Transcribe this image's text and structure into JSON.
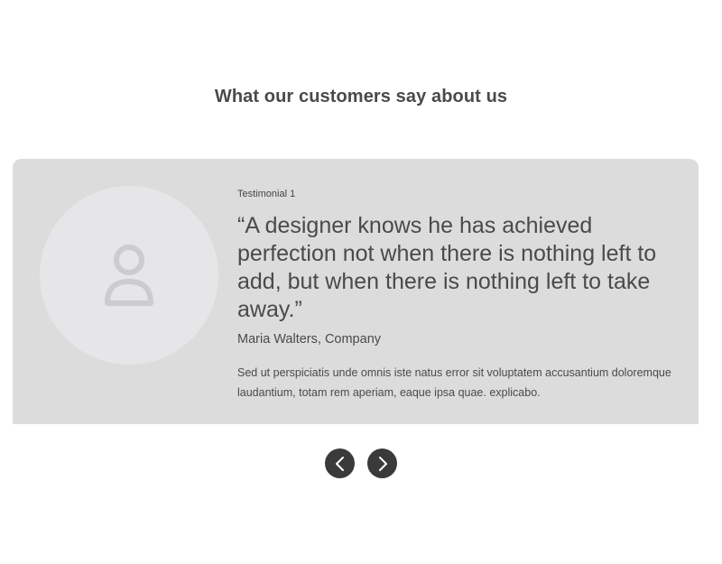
{
  "section": {
    "heading": "What our customers say about us"
  },
  "testimonial": {
    "eyebrow": "Testimonial 1",
    "quote": "“A designer knows he has achieved perfection not when there is nothing left to add, but when there is nothing left to take away.”",
    "author": "Maria Walters, Company",
    "body": "Sed ut perspiciatis unde omnis iste natus error sit voluptatem accusantium doloremque laudantium, totam rem aperiam, eaque ipsa quae. explicabo.",
    "avatar_icon": "user-icon"
  },
  "navigation": {
    "prev_icon": "chevron-left-icon",
    "next_icon": "chevron-right-icon"
  },
  "colors": {
    "card_background": "#dcdcdc",
    "avatar_background": "#e6e6e9",
    "nav_button": "#3a3a3a"
  }
}
